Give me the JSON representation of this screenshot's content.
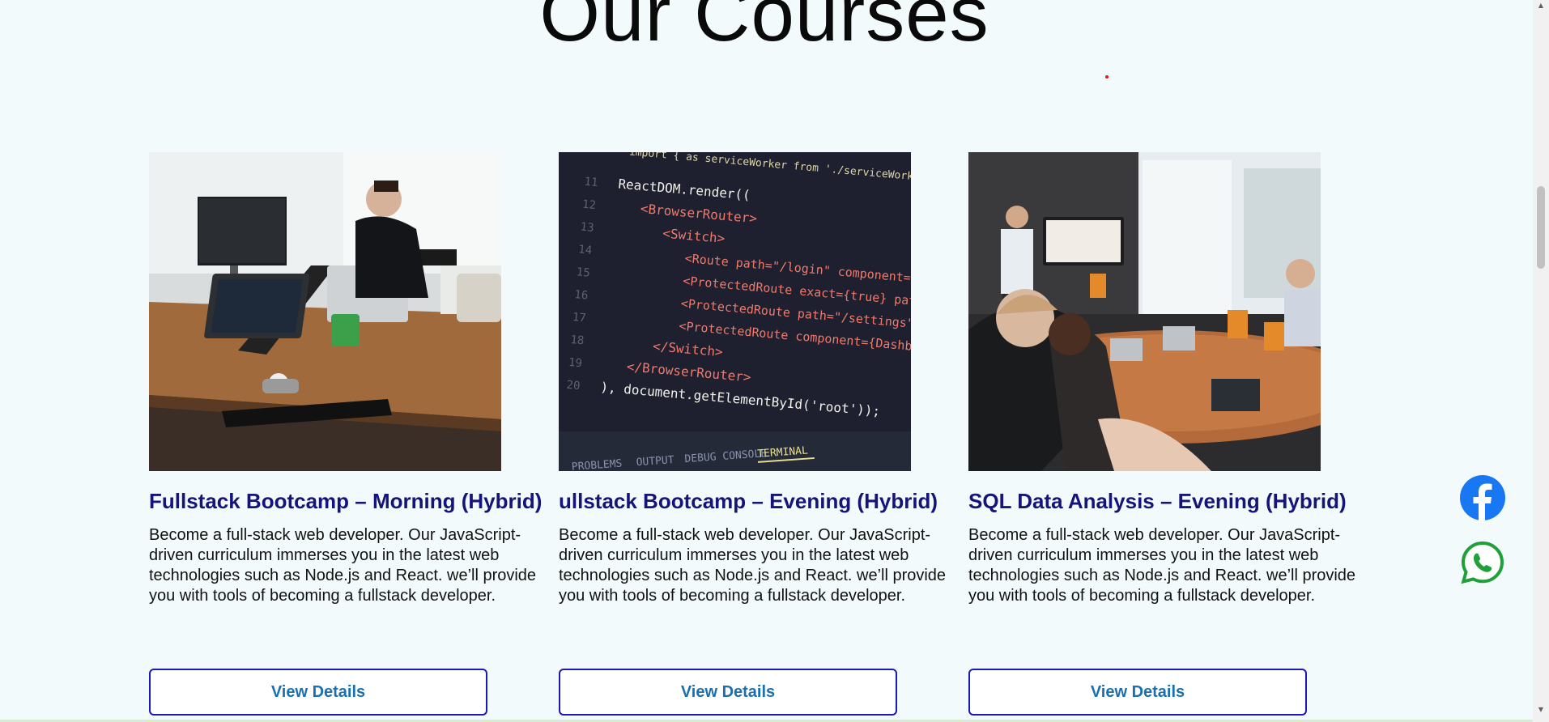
{
  "section": {
    "title": "Our Courses"
  },
  "courses": [
    {
      "title": "Fullstack Bootcamp – Morning (Hybrid)",
      "description": "Become a full-stack web developer. Our JavaScript-driven curriculum immerses you in the latest web technologies such as Node.js and React. we’ll provide you with tools of becoming a fullstack developer.",
      "button_label": "View Details",
      "image_alt": "Developer working at laptops in an office"
    },
    {
      "title": "ullstack Bootcamp – Evening (Hybrid)",
      "description": "Become a full-stack web developer. Our JavaScript-driven curriculum immerses you in the latest web technologies such as Node.js and React. we’ll provide you with tools of becoming a fullstack developer.",
      "button_label": "View Details",
      "image_alt": "Code editor showing React routing code",
      "code": {
        "line0": "import { as serviceWorker from './serviceWorker",
        "line1": "ReactDOM.render((",
        "line2": "<BrowserRouter>",
        "line3": "<Switch>",
        "line4": "<Route path=\"/login\" component={Login} />",
        "line5": "<ProtectedRoute exact={true} path=\"/\" compone",
        "line6": "<ProtectedRoute path=\"/settings\" component={Se",
        "line7": "<ProtectedRoute component={Dashboard} />",
        "line8": "</Switch>",
        "line9": "</BrowserRouter>",
        "line10": "), document.getElementById('root'));",
        "ln11": "11",
        "ln12": "12",
        "ln13": "13",
        "ln14": "14",
        "ln15": "15",
        "ln16": "16",
        "ln17": "17",
        "ln18": "18",
        "ln19": "19",
        "ln20": "20",
        "tab_problems": "PROBLEMS",
        "tab_output": "OUTPUT",
        "tab_debug": "DEBUG CONSOLE",
        "tab_terminal": "TERMINAL"
      }
    },
    {
      "title": "SQL Data Analysis – Evening (Hybrid)",
      "description": "Become a full-stack web developer. Our JavaScript-driven curriculum immerses you in the latest web technologies such as Node.js and React. we’ll provide you with tools of becoming a fullstack developer.",
      "button_label": "View Details",
      "image_alt": "Classroom with presenter and students at laptops"
    }
  ],
  "social": {
    "facebook_icon": "facebook-icon",
    "whatsapp_icon": "whatsapp-icon",
    "facebook_color": "#1877f2",
    "whatsapp_color": "#25a32e"
  },
  "colors": {
    "background": "#f3fafc",
    "title_text": "#14147a",
    "button_border": "#1a1ab8",
    "button_text": "#1a6fb0"
  }
}
